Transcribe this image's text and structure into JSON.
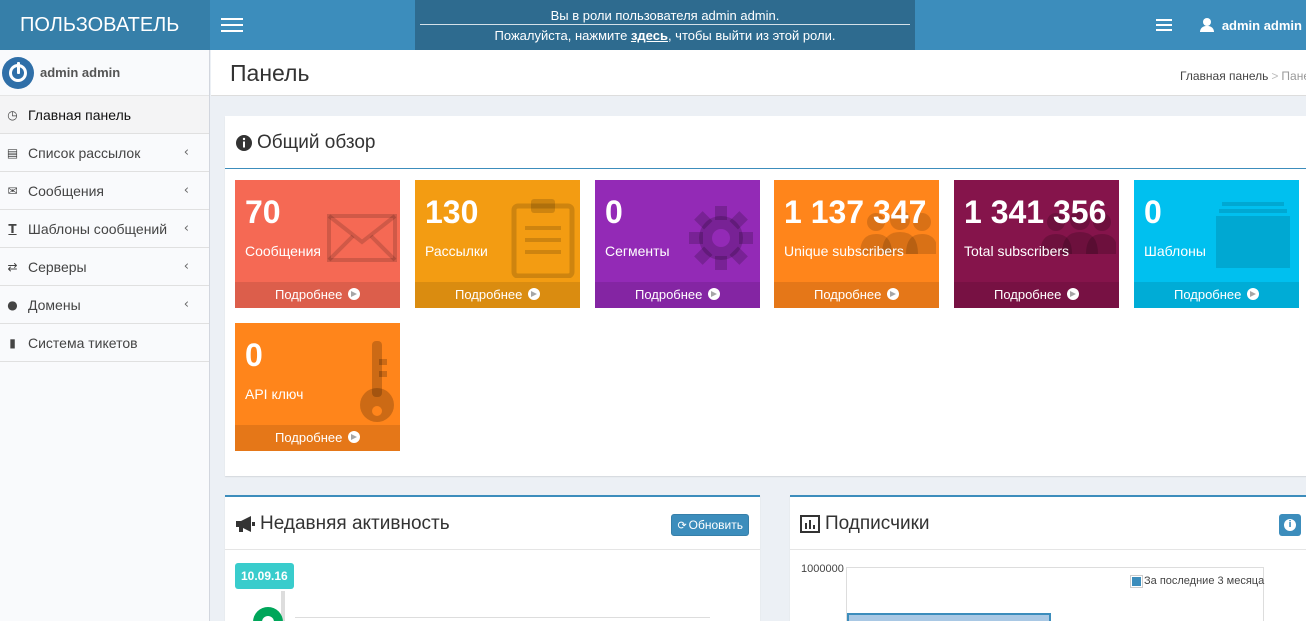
{
  "header": {
    "logo": "ПОЛЬЗОВАТЕЛЬ",
    "impersonate": {
      "line1": "Вы в роли пользователя admin admin.",
      "line2_before": "Пожалуйста, нажмите ",
      "line2_link": "здесь",
      "line2_after": ", чтобы выйти из этой роли."
    },
    "user": "admin admin"
  },
  "sidebar": {
    "user": "admin admin",
    "items": [
      {
        "label": "Главная панель",
        "icon": "dashboard-icon"
      },
      {
        "label": "Список рассылок",
        "icon": "list-icon"
      },
      {
        "label": "Сообщения",
        "icon": "envelope-icon"
      },
      {
        "label": "Шаблоны сообщений",
        "icon": "text-icon"
      },
      {
        "label": "Серверы",
        "icon": "exchange-icon"
      },
      {
        "label": "Домены",
        "icon": "globe-icon"
      },
      {
        "label": "Система тикетов",
        "icon": "book-icon"
      }
    ]
  },
  "page": {
    "title": "Панель",
    "breadcrumb": [
      "Главная панель",
      "Пане"
    ]
  },
  "overview": {
    "title": "Общий обзор",
    "more_label": "Подробнее",
    "tiles": [
      {
        "value": "70",
        "label": "Сообщения",
        "color": "#f56954",
        "icon": "envelope-icon"
      },
      {
        "value": "130",
        "label": "Рассылки",
        "color": "#f39c12",
        "icon": "clipboard-icon"
      },
      {
        "value": "0",
        "label": "Сегменты",
        "color": "#932ab6",
        "icon": "gear-icon"
      },
      {
        "value": "1 137 347",
        "label": "Unique subscribers",
        "color": "#ff851b",
        "icon": "users-icon"
      },
      {
        "value": "1 341 356",
        "label": "Total subscribers",
        "color": "#85144b",
        "icon": "users-icon"
      },
      {
        "value": "0",
        "label": "Шаблоны",
        "color": "#00c0ef",
        "icon": "templates-icon"
      },
      {
        "value": "0",
        "label": "API ключ",
        "color": "#ff851b",
        "icon": "key-icon"
      }
    ]
  },
  "activity": {
    "title": "Недавняя активность",
    "refresh_label": "Обновить",
    "date": "10.09.16"
  },
  "subscribers": {
    "title": "Подписчики",
    "ytick": "1000000",
    "legend": "За последние 3 месяца"
  }
}
